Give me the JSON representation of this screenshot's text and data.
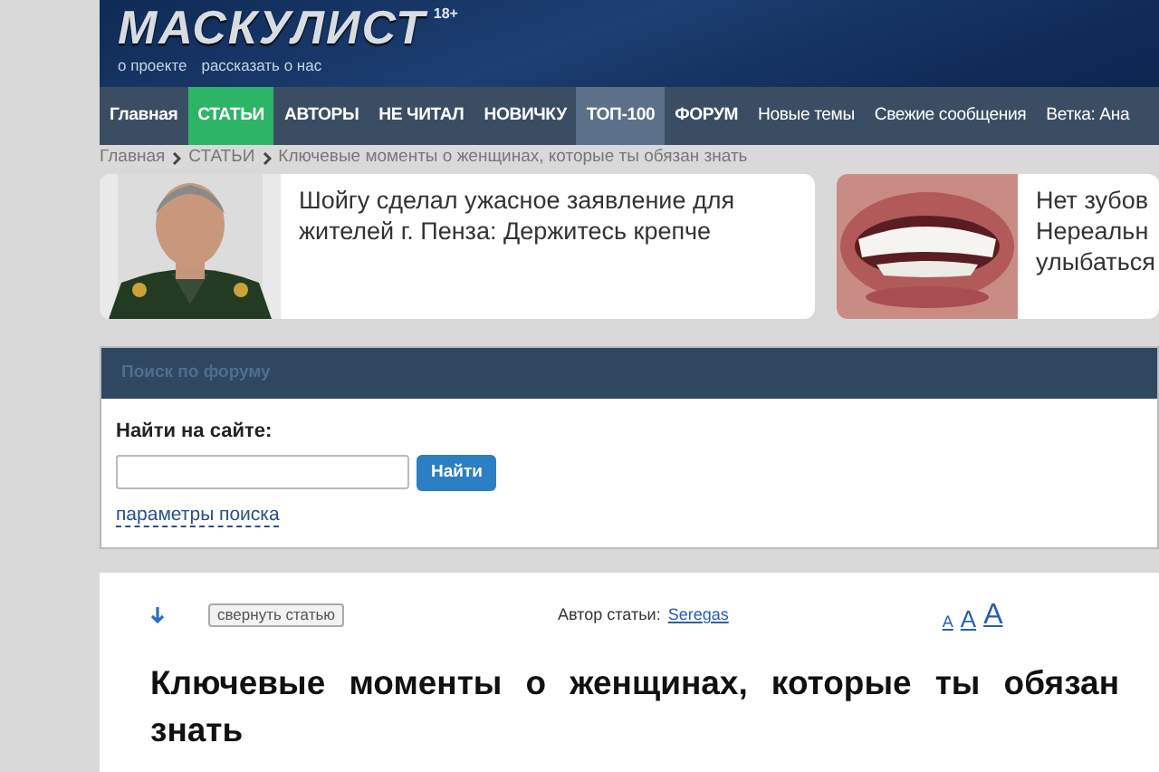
{
  "header": {
    "logo": "МАСКУЛИСТ",
    "age_mark": "18+",
    "links": [
      "о проекте",
      "рассказать о нас"
    ]
  },
  "nav": [
    {
      "label": "Главная",
      "selected": false,
      "highlighted": false
    },
    {
      "label": "СТАТЬИ",
      "selected": true,
      "highlighted": false
    },
    {
      "label": "АВТОРЫ",
      "selected": false,
      "highlighted": false
    },
    {
      "label": "НЕ ЧИТАЛ",
      "selected": false,
      "highlighted": false
    },
    {
      "label": "НОВИЧКУ",
      "selected": false,
      "highlighted": false
    },
    {
      "label": "ТОП-100",
      "selected": false,
      "highlighted": true
    },
    {
      "label": "ФОРУМ",
      "selected": false,
      "highlighted": false
    },
    {
      "label": "Новые темы",
      "selected": false,
      "highlighted": false
    },
    {
      "label": "Свежие сообщения",
      "selected": false,
      "highlighted": false
    },
    {
      "label": "Ветка: Ана",
      "selected": false,
      "highlighted": false
    }
  ],
  "breadcrumb": [
    "Главная",
    "СТАТЬИ",
    "Ключевые моменты о женщинах, которые ты обязан знать"
  ],
  "ads": [
    {
      "kind": "figure",
      "lines": [
        "Шойгу сделал ужасное заявление для жителей г. Пенза: Держитесь крепче"
      ]
    },
    {
      "kind": "smile",
      "lines": [
        "Нет зубов",
        "Нереальн",
        "улыбаться"
      ]
    }
  ],
  "search": {
    "title": "Поиск по форуму",
    "label": "Найти на сайте:",
    "button": "Найти",
    "options_link": "параметры поиска"
  },
  "article": {
    "collapse_button": "свернуть статью",
    "author_label": "Автор статьи:",
    "author": "Seregas",
    "font_sizes": [
      "A",
      "A",
      "A"
    ],
    "title": "Ключевые моменты о женщинах, которые ты обязан знать"
  }
}
